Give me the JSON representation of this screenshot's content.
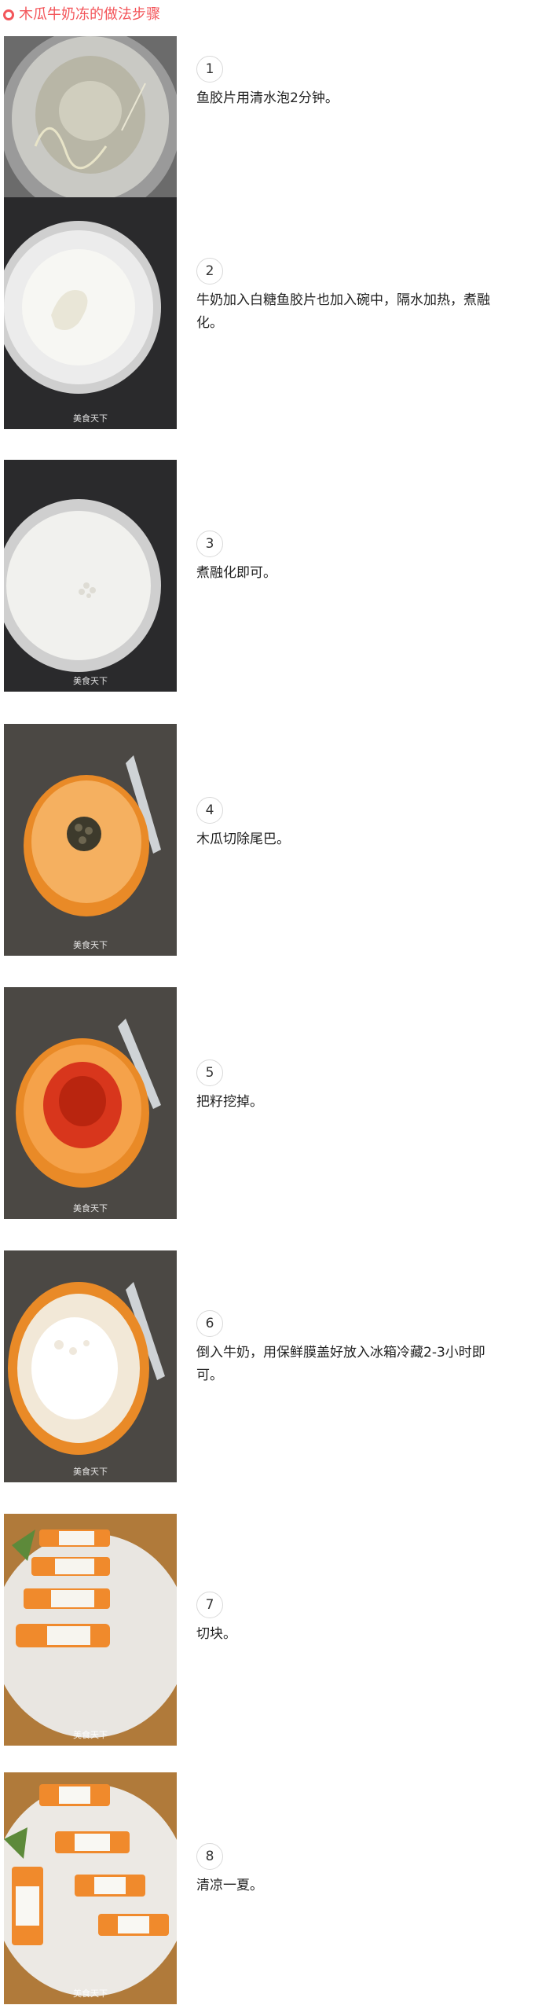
{
  "header": {
    "title": "木瓜牛奶冻的做法步骤",
    "icon": "circle-icon",
    "accent": "#f3555a"
  },
  "watermark": "美食天下",
  "steps": [
    {
      "num": "1",
      "text": "鱼胶片用清水泡2分钟。"
    },
    {
      "num": "2",
      "text": "牛奶加入白糖鱼胶片也加入碗中，隔水加热，煮融化。"
    },
    {
      "num": "3",
      "text": "煮融化即可。"
    },
    {
      "num": "4",
      "text": "木瓜切除尾巴。"
    },
    {
      "num": "5",
      "text": "把籽挖掉。"
    },
    {
      "num": "6",
      "text": "倒入牛奶，用保鲜膜盖好放入冰箱冷藏2-3小时即可。"
    },
    {
      "num": "7",
      "text": "切块。"
    },
    {
      "num": "8",
      "text": "清凉一夏。"
    }
  ]
}
